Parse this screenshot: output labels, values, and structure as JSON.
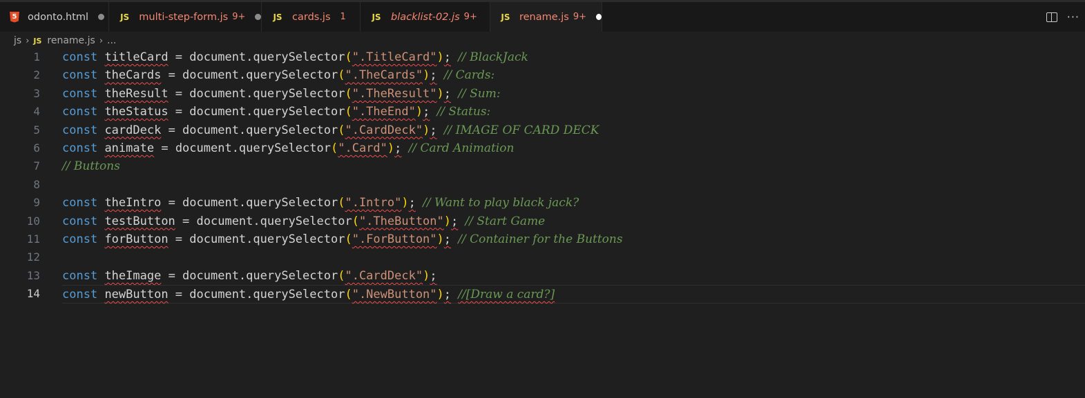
{
  "tabs": [
    {
      "name": "odonto.html",
      "icon": "5",
      "badge": "",
      "style": "normal"
    },
    {
      "name": "multi-step-form.js",
      "icon": "JS",
      "badge": "9+",
      "style": "err"
    },
    {
      "name": "cards.js",
      "icon": "JS",
      "badge": "1",
      "style": "err"
    },
    {
      "name": "blacklist-02.js",
      "icon": "JS",
      "badge": "9+",
      "style": "err-italic"
    },
    {
      "name": "rename.js",
      "icon": "JS",
      "badge": "9+",
      "style": "err"
    }
  ],
  "breadcrumb": {
    "folder": "js",
    "file_icon": "JS",
    "file": "rename.js",
    "more": "..."
  },
  "editor": {
    "lines": [
      {
        "n": "1",
        "decl": "const",
        "name": "titleCard",
        "rhs": "document.querySelector",
        "arg": "\".TitleCard\"",
        "comment": "// BlackJack"
      },
      {
        "n": "2",
        "decl": "const",
        "name": "theCards",
        "rhs": "document.querySelector",
        "arg": "\".TheCards\"",
        "comment": "// Cards:"
      },
      {
        "n": "3",
        "decl": "const",
        "name": "theResult",
        "rhs": "document.querySelector",
        "arg": "\".TheResult\"",
        "comment": "// Sum:"
      },
      {
        "n": "4",
        "decl": "const",
        "name": "theStatus",
        "rhs": "document.querySelector",
        "arg": "\".TheEnd\"",
        "comment": "// Status:"
      },
      {
        "n": "5",
        "decl": "const",
        "name": "cardDeck",
        "rhs": "document.querySelector",
        "arg": "\".CardDeck\"",
        "comment": "// IMAGE OF CARD DECK"
      },
      {
        "n": "6",
        "decl": "const",
        "name": "animate",
        "rhs": "document.querySelector",
        "arg": "\".Card\"",
        "comment": "// Card Animation"
      },
      {
        "n": "7",
        "decl": "",
        "name": "",
        "rhs": "",
        "arg": "",
        "comment": "// Buttons"
      },
      {
        "n": "8",
        "decl": "",
        "name": "",
        "rhs": "",
        "arg": "",
        "comment": ""
      },
      {
        "n": "9",
        "decl": "const",
        "name": "theIntro",
        "rhs": "document.querySelector",
        "arg": "\".Intro\"",
        "comment": "// Want to play black jack?"
      },
      {
        "n": "10",
        "decl": "const",
        "name": "testButton",
        "rhs": "document.querySelector",
        "arg": "\".TheButton\"",
        "comment": "// Start Game"
      },
      {
        "n": "11",
        "decl": "const",
        "name": "forButton",
        "rhs": "document.querySelector",
        "arg": "\".ForButton\"",
        "comment": "// Container for the Buttons"
      },
      {
        "n": "12",
        "decl": "",
        "name": "",
        "rhs": "",
        "arg": "",
        "comment": ""
      },
      {
        "n": "13",
        "decl": "const",
        "name": "theImage",
        "rhs": "document.querySelector",
        "arg": "\".CardDeck\"",
        "comment": ""
      },
      {
        "n": "14",
        "decl": "const",
        "name": "newButton",
        "rhs": "document.querySelector",
        "arg": "\".NewButton\"",
        "comment": "//[Draw a card?]"
      }
    ],
    "current_line": "14"
  },
  "colors": {
    "keyword": "#569cd6",
    "string": "#ce9178",
    "comment": "#6a9955",
    "bracket": "#ffd700",
    "error": "#f14c4c",
    "js_icon": "#e9d84a",
    "html_icon": "#e44d26"
  },
  "icons": {
    "split": "split-editor-icon",
    "more": "more-actions-icon"
  }
}
